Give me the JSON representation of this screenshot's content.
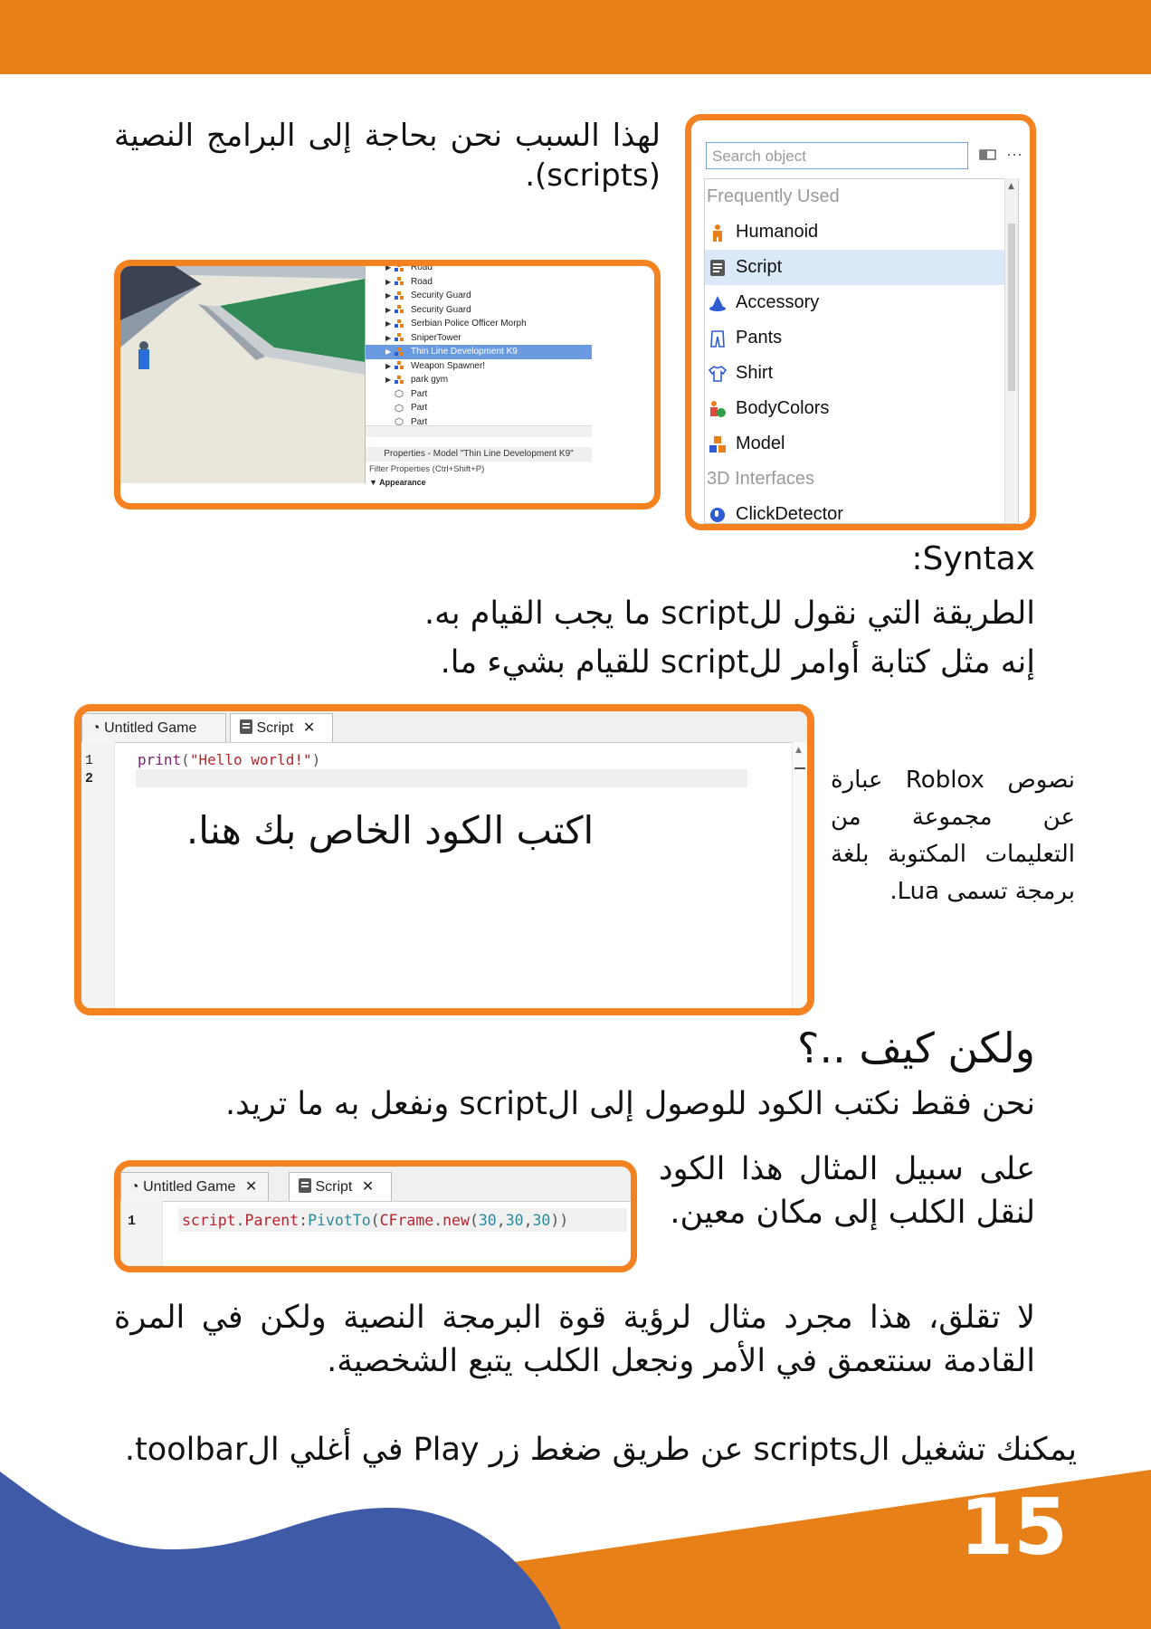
{
  "colors": {
    "accent_orange": "#f58220",
    "header_orange": "#e8801a",
    "wave_blue": "#3f5aa7"
  },
  "intro": {
    "text": "لهذا السبب نحن بحاجة إلى البرامج النصية (scripts)."
  },
  "object_browser": {
    "search_placeholder": "Search object",
    "section_frequently_used": "Frequently Used",
    "items": [
      "Humanoid",
      "Script",
      "Accessory",
      "Pants",
      "Shirt",
      "BodyColors",
      "Model"
    ],
    "section_3d_interfaces": "3D Interfaces",
    "item_click_detector": "ClickDetector"
  },
  "explorer": {
    "items": [
      "Road",
      "Road",
      "Security Guard",
      "Security Guard",
      "Serbian Police Officer Morph",
      "SniperTower",
      "Thin Line Development K9",
      "Weapon Spawner!",
      "park gym",
      "Part",
      "Part",
      "Part"
    ],
    "properties_title": "Properties - Model \"Thin Line Development K9\"",
    "filter_placeholder": "Filter Properties (Ctrl+Shift+P)",
    "section_appearance": "Appearance"
  },
  "syntax": {
    "heading": ":Syntax",
    "line1": "الطريقة التي نقول للscript ما يجب القيام به.",
    "line2": "إنه مثل كتابة أوامر للscript للقيام بشيء ما."
  },
  "editor1": {
    "tab_game": "Untitled Game",
    "tab_script": "Script",
    "line_numbers": [
      "1",
      "2"
    ],
    "code": {
      "fn": "print",
      "open": "(",
      "str": "\"Hello world!\"",
      "close": ")"
    },
    "overlay_text": "اكتب الكود الخاص بك هنا."
  },
  "side_note": {
    "text": "نصوص Roblox عبارة عن مجموعة من التعليمات المكتوبة بلغة برمجة تسمى Lua."
  },
  "how": {
    "heading": "ولكن كيف ..؟",
    "line": "نحن فقط نكتب الكود للوصول إلى الscript ونفعل به ما تريد."
  },
  "example": {
    "text": "على سبيل المثال هذا الكود لنقل الكلب إلى مكان معين."
  },
  "editor2": {
    "tab_game": "Untitled Game",
    "tab_script": "Script",
    "line_number": "1",
    "code": {
      "obj": "script",
      "dot": ".",
      "prop": "Parent",
      "colon": ":",
      "method": "PivotTo",
      "open": "(",
      "cls": "CFrame",
      "dot2": ".",
      "ctor": "new",
      "open2": "(",
      "a": "30",
      "c1": ",",
      "b": "30",
      "c2": ",",
      "c": "30",
      "close": "))"
    }
  },
  "dont_worry": {
    "text": "لا تقلق، هذا مجرد مثال لرؤية قوة البرمجة النصية ولكن في المرة القادمة سنتعمق في الأمر ونجعل الكلب يتبع الشخصية."
  },
  "run_note": {
    "text": "يمكنك تشغيل الscripts عن طريق ضغط زر Play في أغلي الtoolbar."
  },
  "page_number": "15"
}
